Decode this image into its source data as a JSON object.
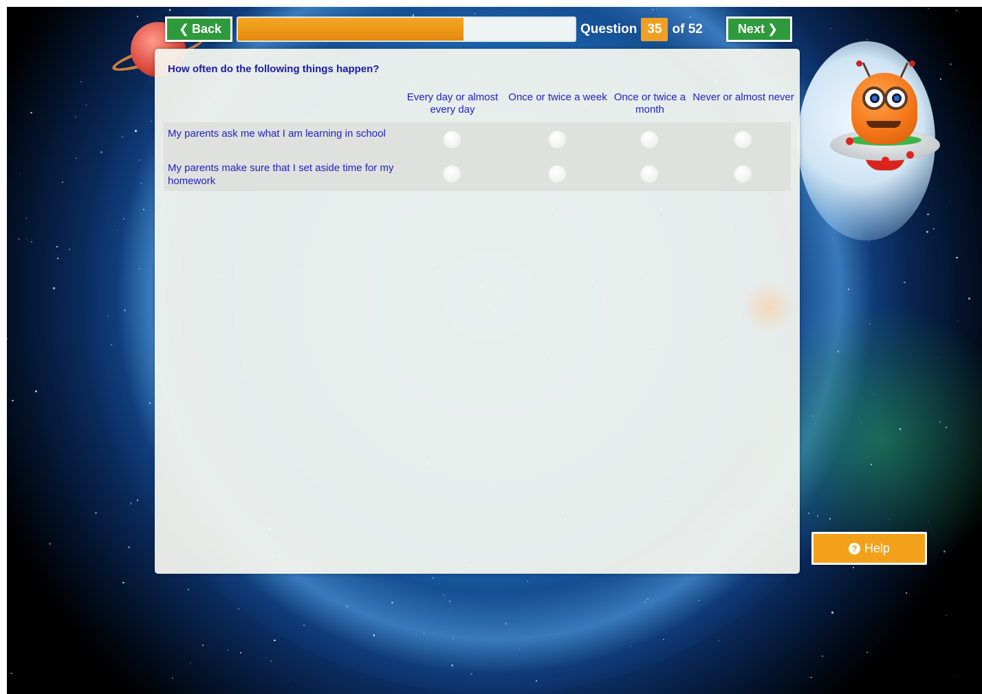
{
  "nav": {
    "back_label": "Back",
    "next_label": "Next",
    "back_icon": "chevron-left-icon",
    "next_icon": "chevron-right-icon"
  },
  "progress": {
    "fraction": 0.67,
    "fill_color": "#f0a024"
  },
  "counter": {
    "prefix": "Question",
    "current": "35",
    "suffix": "of 52"
  },
  "question": {
    "prompt": "How often do the following things happen?",
    "columns": [
      "Every day or almost every day",
      "Once or twice a week",
      "Once or twice a month",
      "Never or almost never"
    ],
    "rows": [
      {
        "label": "My parents ask me what I am learning in school"
      },
      {
        "label": "My parents make sure that I set aside time for my homework"
      }
    ]
  },
  "help": {
    "label": "Help",
    "icon": "question-circle-icon"
  },
  "colors": {
    "nav_button": "#2f9a3c",
    "accent": "#f0a024",
    "text_blue": "#2020c8"
  }
}
